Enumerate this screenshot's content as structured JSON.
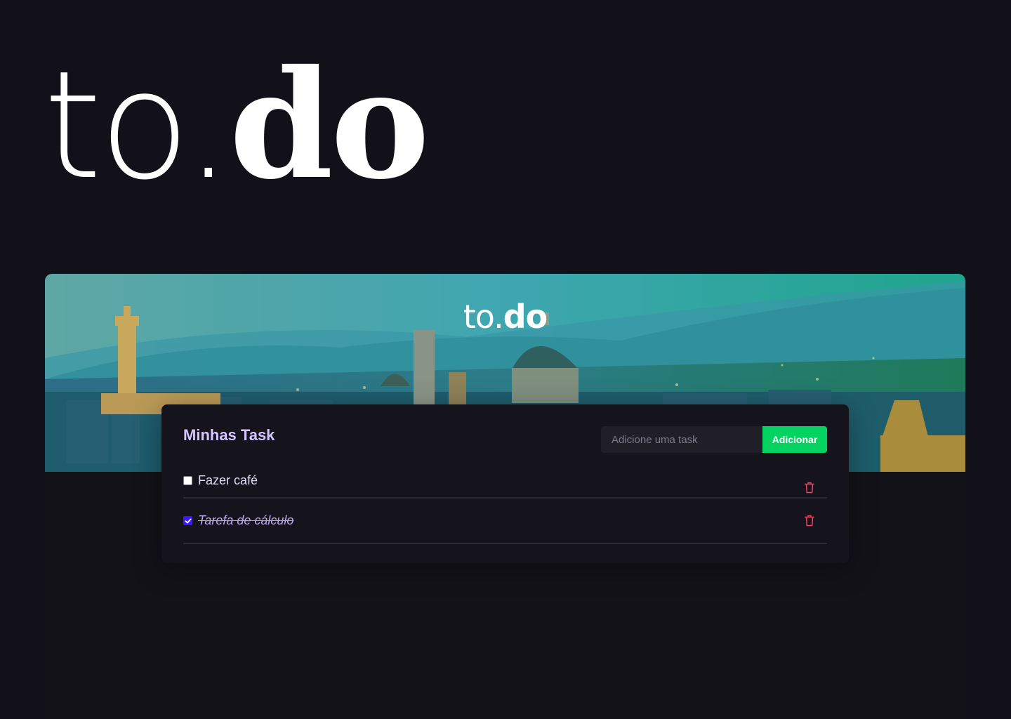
{
  "hero_logo": {
    "light": "to.",
    "bold": "do"
  },
  "banner": {
    "logo_light": "to.",
    "logo_bold": "do"
  },
  "card": {
    "title": "Minhas Task",
    "input": {
      "placeholder": "Adicione uma task",
      "value": ""
    },
    "add_button_label": "Adicionar"
  },
  "tasks": [
    {
      "label": "Fazer café",
      "completed": false
    },
    {
      "label": "Tarefa de cálculo",
      "completed": true
    }
  ],
  "colors": {
    "background": "#121119",
    "accent_green": "#04d361",
    "title_purple": "#d3c6ff",
    "delete_red": "#e83f5b",
    "checkbox_checked": "#3c1aff"
  },
  "icons": {
    "delete": "trash-icon",
    "check": "check-icon"
  }
}
